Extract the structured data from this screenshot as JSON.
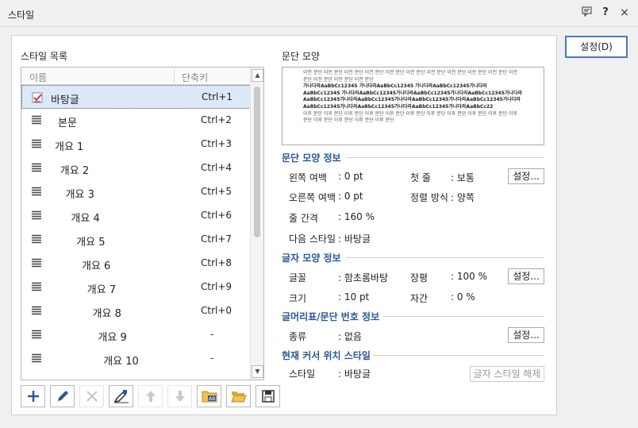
{
  "window": {
    "title": "스타일"
  },
  "style_list": {
    "label": "스타일 목록",
    "col_name": "이름",
    "col_key": "단축키",
    "items": [
      {
        "name": "바탕글",
        "key": "Ctrl+1",
        "selected": true
      },
      {
        "name": "본문",
        "key": "Ctrl+2"
      },
      {
        "name": "개요 1",
        "key": "Ctrl+3"
      },
      {
        "name": "개요 2",
        "key": "Ctrl+4"
      },
      {
        "name": "개요 3",
        "key": "Ctrl+5"
      },
      {
        "name": "개요 4",
        "key": "Ctrl+6"
      },
      {
        "name": "개요 5",
        "key": "Ctrl+7"
      },
      {
        "name": "개요 6",
        "key": "Ctrl+8"
      },
      {
        "name": "개요 7",
        "key": "Ctrl+9"
      },
      {
        "name": "개요 8",
        "key": "Ctrl+0"
      },
      {
        "name": "개요 9",
        "key": "-"
      },
      {
        "name": "개요 10",
        "key": "-"
      }
    ]
  },
  "preview": {
    "label": "문단 모양",
    "prev_text": "이전 문단 이전 문단 이전 문단 이전 문단 이전 문단 이전 문단 이전 문단 이전 문단 이전 문단 이전 문단 이전 문단 이전 문단 이전 문단 이전 문단",
    "sample_text": "가나다라AaBbCc12345 가나다라AaBbCc12345 가나다라AaBbCc12345가나다라AaBbCc12345 가나다라AaBbCc12345가나다라AaBbCc12345가나다라AaBbCc12345가나다라AaBbCc12345가나다라AaBbCc12345가나다라AaBbCc12345가나다라AaBbCc12345가나다라AaBbCc12345가나다라AaBbCc12345가나다라AaBbCc12345가나다라AaBbCc22",
    "next_text": "이후 문단 이후 문단 이후 문단 이후 문단 이후 문단 이후 문단 이후 문단 이후 문단 이후 문단 이후 문단 이후 문단 이후 문단 이후 문단 이후 문단 이후 문단"
  },
  "para_info": {
    "title": "문단 모양 정보",
    "left_margin_label": "왼쪽 여백",
    "left_margin": ": 0 pt",
    "first_line_label": "첫 줄",
    "first_line": ": 보통",
    "right_margin_label": "오른쪽 여백",
    "right_margin": ": 0 pt",
    "align_label": "정렬 방식",
    "align": ": 양쪽",
    "line_spacing_label": "줄 간격",
    "line_spacing": ": 160 %",
    "next_style_label": "다음 스타일",
    "next_style": ": 바탕글",
    "settings": "설정..."
  },
  "char_info": {
    "title": "글자 모양 정보",
    "font_label": "글꼴",
    "font": ": 함초롬바탕",
    "width_label": "장평",
    "width": ": 100 %",
    "size_label": "크기",
    "size": ": 10 pt",
    "spacing_label": "자간",
    "spacing": ": 0 %",
    "settings": "설정..."
  },
  "bullet_info": {
    "title": "글머리표/문단 번호 정보",
    "type_label": "종류",
    "type": ": 없음",
    "settings": "설정..."
  },
  "cursor_info": {
    "title": "현재 커서 위치 스타일",
    "style_label": "스타일",
    "style": ": 바탕글",
    "clear_button": "글자 스타일 해제"
  },
  "ok_button": "설정(D)"
}
